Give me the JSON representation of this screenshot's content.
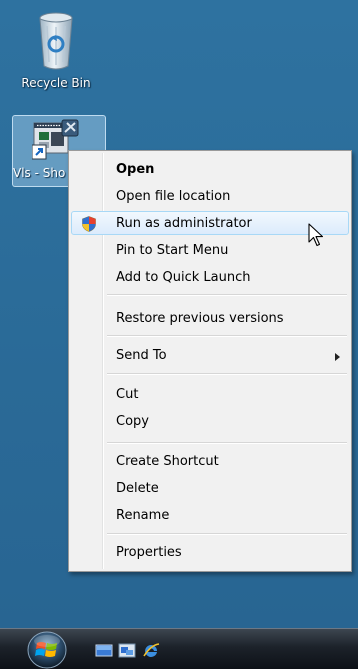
{
  "desktop": {
    "recycle_bin": {
      "label": "Recycle Bin",
      "icon": "recycle-bin-icon"
    },
    "shortcut": {
      "label": "Vls - Sho",
      "icon": "application-shortcut-icon"
    }
  },
  "context_menu": {
    "items": [
      {
        "label": "Open",
        "bold": true
      },
      {
        "label": "Open file location"
      },
      {
        "label": "Run as administrator",
        "icon": "uac-shield-icon",
        "highlighted": true
      },
      {
        "label": "Pin to Start Menu"
      },
      {
        "label": "Add to Quick Launch"
      },
      {
        "label": "Restore previous versions"
      },
      {
        "label": "Send To",
        "submenu": true
      },
      {
        "label": "Cut"
      },
      {
        "label": "Copy"
      },
      {
        "label": "Create Shortcut"
      },
      {
        "label": "Delete"
      },
      {
        "label": "Rename"
      },
      {
        "label": "Properties"
      }
    ]
  },
  "taskbar": {
    "start_button": "windows-orb-icon",
    "quick_launch": [
      "show-desktop-icon",
      "switch-windows-icon",
      "internet-explorer-icon"
    ]
  },
  "colors": {
    "desktop_bg": "#2b6c98",
    "menu_bg": "#f1f1f1",
    "highlight_border": "#a8d8f6",
    "taskbar": "#1c222a"
  }
}
